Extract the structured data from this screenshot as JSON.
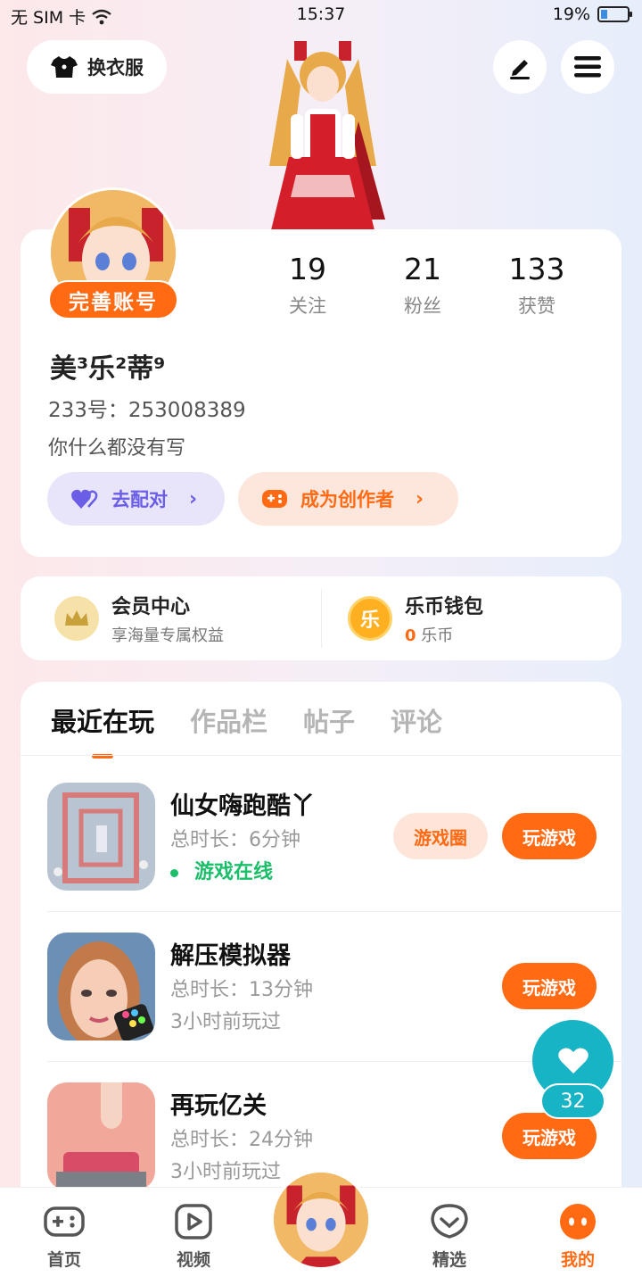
{
  "status_bar": {
    "carrier": "无 SIM 卡",
    "time": "15:37",
    "battery": "19%"
  },
  "header": {
    "outfit_label": "换衣服"
  },
  "profile": {
    "badge": "完善账号",
    "stats": [
      {
        "value": "19",
        "label": "关注"
      },
      {
        "value": "21",
        "label": "粉丝"
      },
      {
        "value": "133",
        "label": "获赞"
      }
    ],
    "nickname": "美³乐²蒂⁹",
    "uid": "233号：253008389",
    "bio": "你什么都没有写",
    "match_label": "去配对",
    "creator_label": "成为创作者"
  },
  "member": {
    "title": "会员中心",
    "subtitle": "享海量专属权益"
  },
  "wallet": {
    "title": "乐币钱包",
    "amount": "0",
    "unit": "乐币",
    "coin_glyph": "乐"
  },
  "tabs": [
    "最近在玩",
    "作品栏",
    "帖子",
    "评论"
  ],
  "games": [
    {
      "title": "仙女嗨跑酷丫",
      "duration": "总时长：6分钟",
      "status": "游戏在线",
      "circle_label": "游戏圈",
      "play_label": "玩游戏"
    },
    {
      "title": "解压模拟器",
      "duration": "总时长：13分钟",
      "status": "3小时前玩过",
      "play_label": "玩游戏"
    },
    {
      "title": "再玩亿关",
      "duration": "总时长：24分钟",
      "status": "3小时前玩过",
      "play_label": "玩游戏"
    }
  ],
  "like": {
    "count": "32"
  },
  "nav": [
    {
      "label": "首页",
      "icon": "gamepad-icon"
    },
    {
      "label": "视频",
      "icon": "video-icon"
    },
    {
      "label": "精选",
      "icon": "heart-chat-icon"
    },
    {
      "label": "我的",
      "icon": "profile-face-icon"
    }
  ],
  "colors": {
    "accent": "#ff6a13",
    "teal": "#17b4c5",
    "online": "#1bbf6a",
    "purple": "#6a5de6"
  }
}
